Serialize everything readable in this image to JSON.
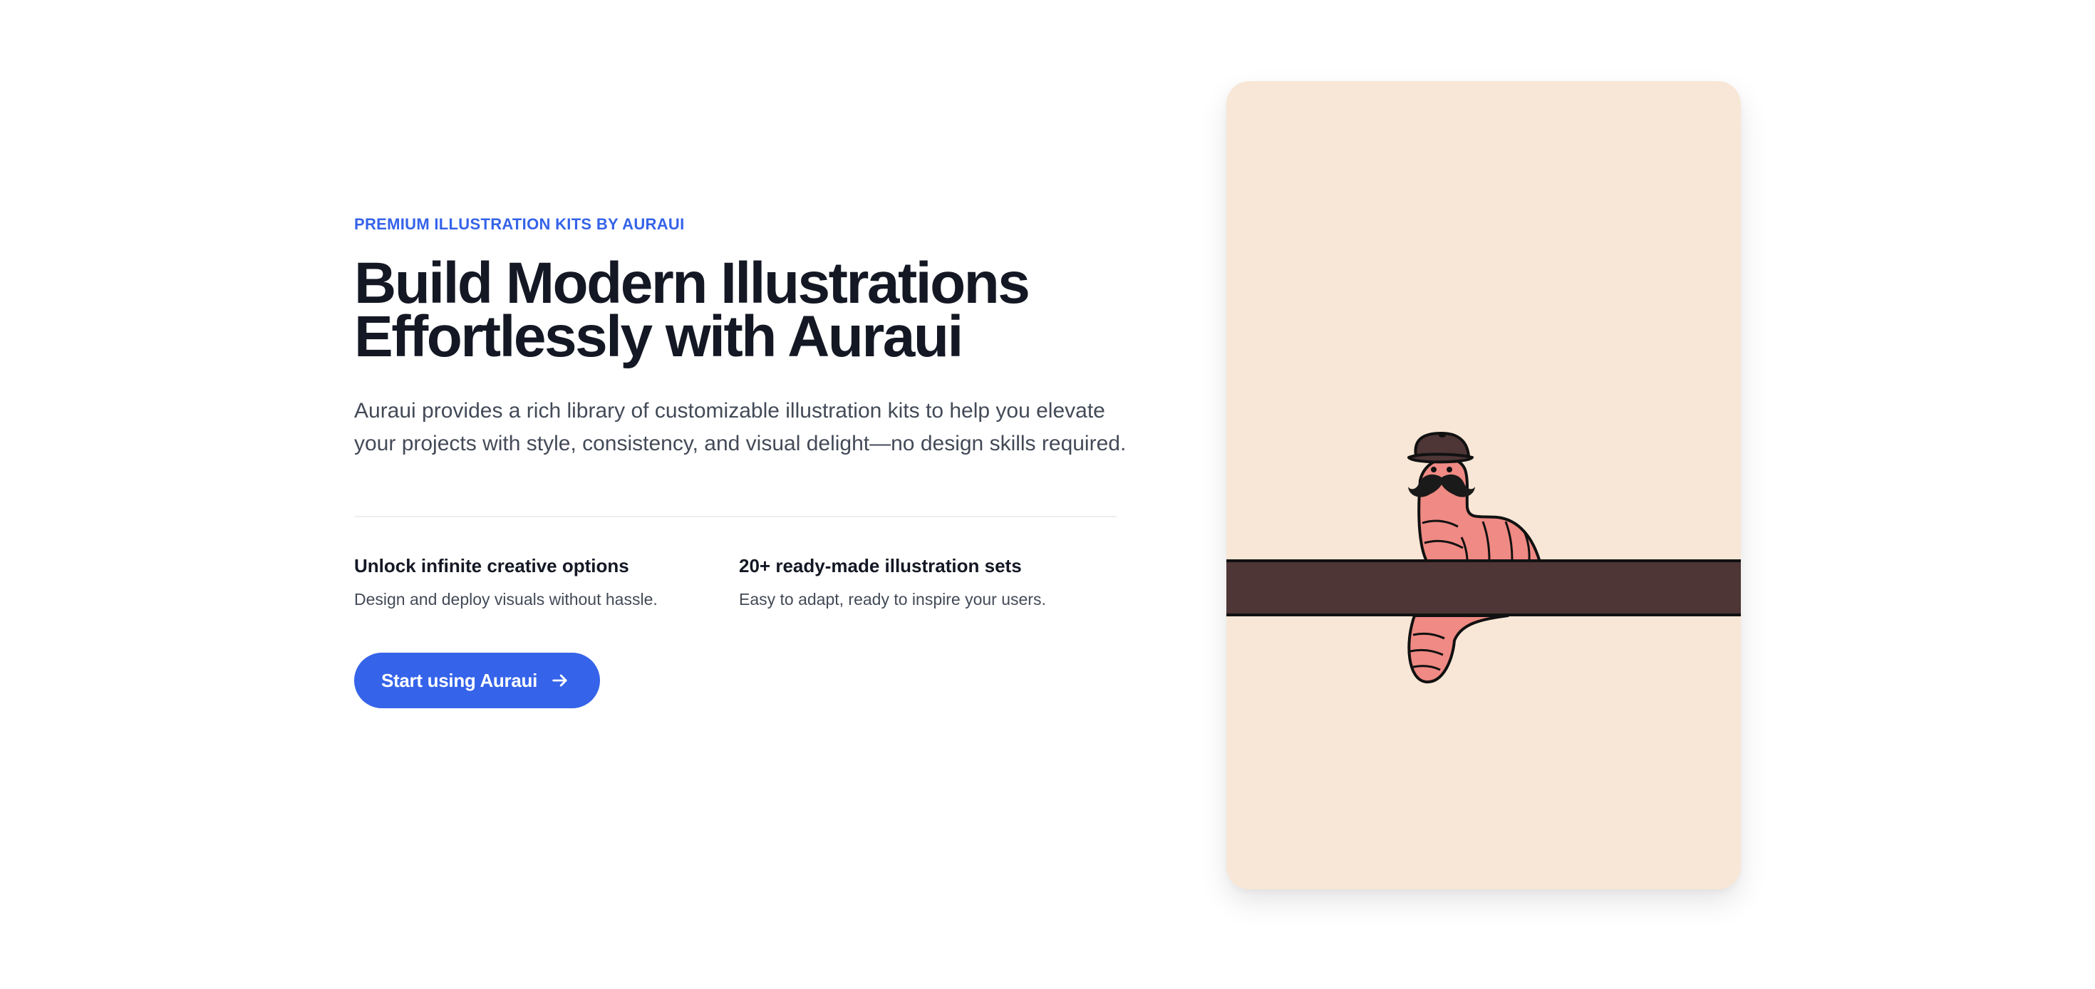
{
  "hero": {
    "eyebrow": "PREMIUM ILLUSTRATION KITS BY AURAUI",
    "headline_line1": "Build Modern Illustrations",
    "headline_line2": "Effortlessly with Auraui",
    "lead": "Auraui provides a rich library of customizable illustration kits to help you elevate your projects with style, consistency, and visual delight—no design skills required."
  },
  "features": [
    {
      "title": "Unlock infinite creative options",
      "description": "Design and deploy visuals without hassle."
    },
    {
      "title": "20+ ready-made illustration sets",
      "description": "Easy to adapt, ready to inspire your users."
    }
  ],
  "cta": {
    "label": "Start using Auraui",
    "icon": "arrow-right-icon"
  },
  "illustration": {
    "subject": "worm-with-hat-and-mustache",
    "background_color": "#f8e7d6",
    "bar_color": "#4e3536",
    "worm_color": "#f08a84"
  },
  "colors": {
    "accent": "#3563e9",
    "heading": "#141824",
    "body": "#434a57"
  }
}
